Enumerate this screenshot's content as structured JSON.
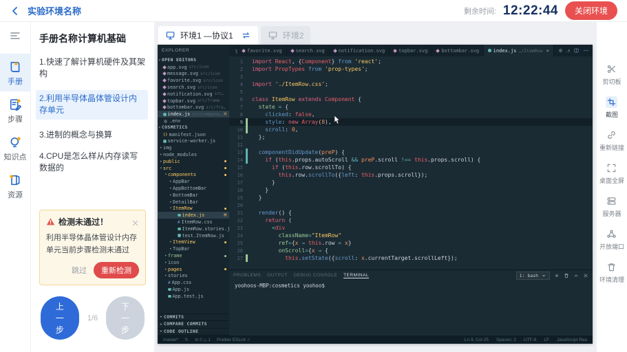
{
  "header": {
    "title": "实验环境名称",
    "time_label": "剩余时间:",
    "time_value": "12:22:44",
    "close_button": "关闭环境",
    "icons": {
      "back": "chevron-left-icon"
    }
  },
  "left_sidebar": {
    "collapse_icon": "collapse-menu-icon",
    "items": [
      {
        "label": "手册",
        "icon": "book",
        "active": true
      },
      {
        "label": "步骤",
        "icon": "steps",
        "active": false
      },
      {
        "label": "知识点",
        "icon": "bulb",
        "active": false
      },
      {
        "label": "资源",
        "icon": "resource",
        "active": false
      }
    ]
  },
  "manual": {
    "title": "手册名称计算机基础",
    "items": [
      {
        "label": "1.快速了解计算机硬件及其架构",
        "active": false
      },
      {
        "label": "2.利用半导体晶体管设计内存单元",
        "active": true
      },
      {
        "label": "3.进制的概念与换算",
        "active": false
      },
      {
        "label": "4.CPU是怎么样从内存读写数据的",
        "active": false
      }
    ]
  },
  "alert": {
    "icon": "warning-triangle-icon",
    "title": "检测未通过！",
    "body": "利用半导体晶体管设计内存单元当前步骤检测未通过",
    "skip_label": "跳过",
    "retry_label": "重新检测"
  },
  "stepper": {
    "prev_label": "上一步",
    "progress": "1/6",
    "next_label": "下一步"
  },
  "env_tabs": [
    {
      "label": "环境1 —协议1",
      "active": true,
      "has_swap_icon": true
    },
    {
      "label": "环境2",
      "active": false,
      "has_swap_icon": false
    }
  ],
  "right_sidebar": {
    "items": [
      {
        "label": "剪切板",
        "icon": "scissors",
        "active": false
      },
      {
        "label": "截图",
        "icon": "crop",
        "active": true
      },
      {
        "label": "重新链接",
        "icon": "link",
        "active": false
      },
      {
        "label": "桌面全屏",
        "icon": "fullscreen",
        "active": false
      },
      {
        "label": "服务器",
        "icon": "server",
        "active": false
      },
      {
        "label": "开放端口",
        "icon": "ports",
        "active": false
      },
      {
        "label": "环境清理",
        "icon": "trash",
        "active": false
      }
    ]
  },
  "vscode": {
    "explorer_title": "EXPLORER",
    "editor_tabs": [
      {
        "label": "ge.svg",
        "type": "svg",
        "active": false,
        "first": true
      },
      {
        "label": "favorite.svg",
        "type": "svg",
        "active": false
      },
      {
        "label": "search.svg",
        "type": "svg",
        "active": false
      },
      {
        "label": "notification.svg",
        "type": "svg",
        "active": false
      },
      {
        "label": "topbar.svg",
        "type": "svg",
        "active": false
      },
      {
        "label": "bottombar.svg",
        "type": "svg",
        "active": false
      },
      {
        "label": "index.js",
        "suffix": "…/ItemRow",
        "type": "js",
        "active": true,
        "closable": true
      },
      {
        "label": ".env",
        "type": "gear",
        "active": false
      }
    ],
    "tab_action_icons": [
      "split-editor-icon",
      "more-actions-icon"
    ],
    "tree": [
      {
        "h": true,
        "label": "OPEN EDITORS"
      },
      {
        "d": 1,
        "icon": "svg",
        "label": "app.svg",
        "meta": "src/icon"
      },
      {
        "d": 1,
        "icon": "svg",
        "label": "message.svg",
        "meta": "src/icon"
      },
      {
        "d": 1,
        "icon": "svg",
        "label": "favorite.svg",
        "meta": "src/icon"
      },
      {
        "d": 1,
        "icon": "svg",
        "label": "search.svg",
        "meta": "src/icon"
      },
      {
        "d": 1,
        "icon": "svg",
        "label": "notification.svg",
        "meta": "src/icon"
      },
      {
        "d": 1,
        "icon": "svg",
        "label": "topbar.svg",
        "meta": "src/frame"
      },
      {
        "d": 1,
        "icon": "svg",
        "label": "bottombar.svg",
        "meta": "src/frame"
      },
      {
        "d": 1,
        "icon": "js",
        "label": "index.js",
        "meta": "src/components…",
        "badge": "M",
        "sel": true
      },
      {
        "d": 1,
        "icon": "gear",
        "label": ".env"
      },
      {
        "h": true,
        "label": "COSMETICS"
      },
      {
        "d": 1,
        "icon": "json",
        "label": "manifest.json"
      },
      {
        "d": 1,
        "icon": "js",
        "label": "service-worker.js"
      },
      {
        "d": 1,
        "a": "closed",
        "label": "img"
      },
      {
        "d": 1,
        "a": "closed",
        "label": "node_modules"
      },
      {
        "d": 1,
        "a": "closed",
        "label": "public",
        "c": "or",
        "dot": true
      },
      {
        "d": 1,
        "a": "open",
        "label": "src",
        "c": "or",
        "dot": true
      },
      {
        "d": 2,
        "a": "open",
        "label": "components",
        "c": "or",
        "dot": true
      },
      {
        "d": 3,
        "a": "closed",
        "label": "AppBar"
      },
      {
        "d": 3,
        "a": "closed",
        "label": "AppBottomBar"
      },
      {
        "d": 3,
        "a": "closed",
        "label": "BottomBar"
      },
      {
        "d": 3,
        "a": "closed",
        "label": "DetailBar"
      },
      {
        "d": 3,
        "a": "open",
        "label": "ItemRow",
        "c": "or",
        "dot": true
      },
      {
        "d": 4,
        "icon": "js",
        "label": "index.js",
        "c": "or",
        "badge": "M",
        "sel": true
      },
      {
        "d": 4,
        "icon": "css",
        "label": "ItemRow.css"
      },
      {
        "d": 4,
        "icon": "js",
        "label": "ItemRow.stories.js"
      },
      {
        "d": 4,
        "icon": "js",
        "label": "test.ItemRow.js"
      },
      {
        "d": 3,
        "a": "closed",
        "label": "ItemView",
        "c": "or",
        "dot": true
      },
      {
        "d": 3,
        "a": "closed",
        "label": "TopBar"
      },
      {
        "d": 2,
        "a": "closed",
        "label": "frame",
        "c": "gr",
        "dot": true
      },
      {
        "d": 2,
        "a": "closed",
        "label": "icon"
      },
      {
        "d": 2,
        "a": "closed",
        "label": "pages",
        "c": "or",
        "dot": true
      },
      {
        "d": 2,
        "a": "closed",
        "label": "stories"
      },
      {
        "d": 2,
        "icon": "css",
        "label": "App.css"
      },
      {
        "d": 2,
        "icon": "js",
        "label": "App.js"
      },
      {
        "d": 2,
        "icon": "js",
        "label": "App.test.js"
      }
    ],
    "bottom_sections": [
      "COMMITS",
      "COMPARE COMMITS",
      "CODE OUTLINE"
    ],
    "code": {
      "active_line": 9,
      "markers": {
        "9": "g",
        "10": "g",
        "13": "c",
        "14": "c",
        "27": "g"
      },
      "lines": [
        [
          [
            "k",
            "import "
          ],
          [
            "r",
            "React"
          ],
          [
            "w",
            ", {"
          ],
          [
            "r",
            "Component"
          ],
          [
            "w",
            "} "
          ],
          [
            "b",
            "from "
          ],
          [
            "s",
            "'react'"
          ],
          [
            "w",
            ";"
          ]
        ],
        [
          [
            "k",
            "import "
          ],
          [
            "r",
            "PropTypes"
          ],
          [
            "w",
            " "
          ],
          [
            "b",
            "from "
          ],
          [
            "s",
            "'prop-types'"
          ],
          [
            "w",
            ";"
          ]
        ],
        [],
        [
          [
            "k",
            "import "
          ],
          [
            "s",
            "'./ItemRow.css'"
          ],
          [
            "w",
            ";"
          ]
        ],
        [],
        [
          [
            "k",
            "class "
          ],
          [
            "s",
            "ItemRow"
          ],
          [
            "k",
            " extends "
          ],
          [
            "r",
            "Component"
          ],
          [
            "w",
            " {"
          ]
        ],
        [
          [
            "w",
            "  "
          ],
          [
            "g",
            "state"
          ],
          [
            "cy",
            " = "
          ],
          [
            "w",
            "{"
          ]
        ],
        [
          [
            "w",
            "    "
          ],
          [
            "b",
            "clicked"
          ],
          [
            "w",
            ": "
          ],
          [
            "r",
            "false"
          ],
          [
            "w",
            ","
          ]
        ],
        [
          [
            "w",
            "    "
          ],
          [
            "b",
            "style"
          ],
          [
            "w",
            ": "
          ],
          [
            "k",
            "new "
          ],
          [
            "r",
            "Array"
          ],
          [
            "w",
            "("
          ],
          [
            "o",
            "8"
          ],
          [
            "w",
            "),"
          ]
        ],
        [
          [
            "w",
            "    "
          ],
          [
            "b",
            "scroll"
          ],
          [
            "w",
            ": "
          ],
          [
            "o",
            "0"
          ],
          [
            "w",
            ","
          ]
        ],
        [
          [
            "w",
            "  };"
          ]
        ],
        [],
        [
          [
            "w",
            "  "
          ],
          [
            "b",
            "componentDidUpdate"
          ],
          [
            "w",
            "("
          ],
          [
            "o",
            "preP"
          ],
          [
            "w",
            ") {"
          ]
        ],
        [
          [
            "w",
            "    "
          ],
          [
            "k",
            "if"
          ],
          [
            "w",
            " ("
          ],
          [
            "r",
            "this"
          ],
          [
            "w",
            ".props.autoScroll "
          ],
          [
            "cy",
            "&& "
          ],
          [
            "o",
            "preP"
          ],
          [
            "w",
            ".scroll "
          ],
          [
            "cy",
            "!== "
          ],
          [
            "r",
            "this"
          ],
          [
            "w",
            ".props.scroll) {"
          ]
        ],
        [
          [
            "w",
            "      "
          ],
          [
            "k",
            "if"
          ],
          [
            "w",
            " ("
          ],
          [
            "r",
            "this"
          ],
          [
            "w",
            ".row.scrollTo) {"
          ]
        ],
        [
          [
            "w",
            "        "
          ],
          [
            "r",
            "this"
          ],
          [
            "w",
            ".row."
          ],
          [
            "b",
            "scrollTo"
          ],
          [
            "w",
            "({"
          ],
          [
            "b",
            "left"
          ],
          [
            "w",
            ": "
          ],
          [
            "r",
            "this"
          ],
          [
            "w",
            ".props.scroll});"
          ]
        ],
        [
          [
            "w",
            "      }"
          ]
        ],
        [
          [
            "w",
            "    }"
          ]
        ],
        [
          [
            "w",
            "  }"
          ]
        ],
        [],
        [
          [
            "w",
            "  "
          ],
          [
            "b",
            "render"
          ],
          [
            "w",
            "() {"
          ]
        ],
        [
          [
            "w",
            "    "
          ],
          [
            "k",
            "return"
          ],
          [
            "w",
            " ("
          ]
        ],
        [
          [
            "w",
            "      "
          ],
          [
            "cy",
            "<"
          ],
          [
            "r",
            "div"
          ]
        ],
        [
          [
            "w",
            "        "
          ],
          [
            "g",
            "className"
          ],
          [
            "cy",
            "="
          ],
          [
            "s",
            "\"ItemRow\""
          ]
        ],
        [
          [
            "w",
            "        "
          ],
          [
            "g",
            "ref"
          ],
          [
            "cy",
            "="
          ],
          [
            "w",
            "{"
          ],
          [
            "o",
            "x"
          ],
          [
            "cy",
            " ⇒ "
          ],
          [
            "r",
            "this"
          ],
          [
            "w",
            ".row"
          ],
          [
            "cy",
            " = "
          ],
          [
            "o",
            "x"
          ],
          [
            "w",
            "}"
          ]
        ],
        [
          [
            "w",
            "        "
          ],
          [
            "g",
            "onScroll"
          ],
          [
            "cy",
            "="
          ],
          [
            "w",
            "{"
          ],
          [
            "o",
            "x"
          ],
          [
            "cy",
            " ⇒ "
          ],
          [
            "w",
            "{"
          ]
        ],
        [
          [
            "w",
            "          "
          ],
          [
            "r",
            "this"
          ],
          [
            "w",
            "."
          ],
          [
            "b",
            "setState"
          ],
          [
            "w",
            "({"
          ],
          [
            "b",
            "scroll"
          ],
          [
            "w",
            ": "
          ],
          [
            "o",
            "x"
          ],
          [
            "w",
            ".currentTarget.scrollLeft});"
          ]
        ]
      ]
    },
    "terminal": {
      "tabs": [
        "PROBLEMS",
        "OUTPUT",
        "DEBUG CONSOLE",
        "TERMINAL"
      ],
      "active_tab": "TERMINAL",
      "shell_select": "1: bash",
      "control_icons": [
        "plus-icon",
        "trash-icon",
        "chevron-up-icon",
        "close-icon"
      ],
      "prompt": "yoohoos-MBP:cosmetics yoohoo$"
    },
    "status_bar": {
      "left": [
        "master*",
        "↻",
        "⊘ 0  △ 1",
        "Prettier ESLint ✓"
      ],
      "right": [
        "Ln 9, Col 25",
        "Spaces: 2",
        "UTF-8",
        "LF",
        "JavaScript Rea"
      ]
    }
  }
}
